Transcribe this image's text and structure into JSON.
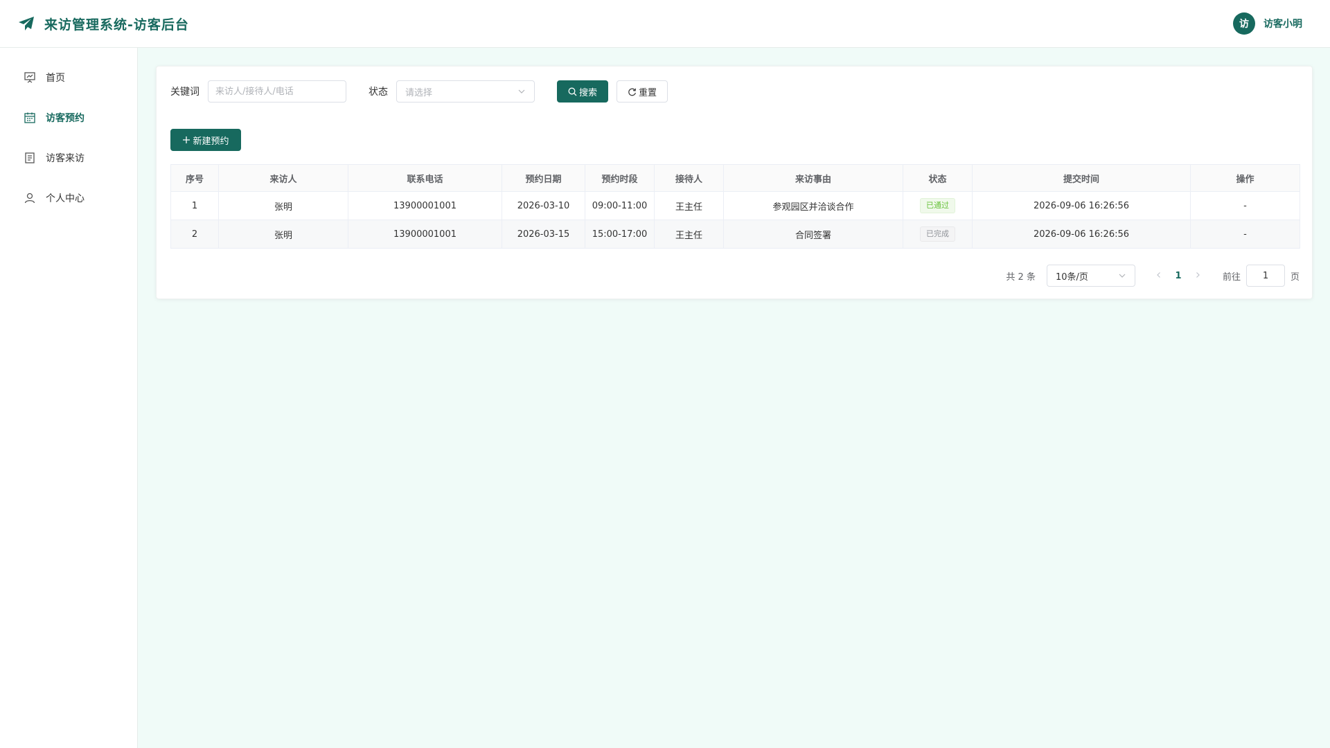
{
  "header": {
    "title": "来访管理系统-访客后台",
    "avatar_text": "访",
    "user_name": "访客小明",
    "brand_color": "#17695e"
  },
  "sidebar": {
    "items": [
      {
        "label": "首页",
        "icon": "presentation-icon",
        "active": false
      },
      {
        "label": "访客预约",
        "icon": "calendar-icon",
        "active": true
      },
      {
        "label": "访客来访",
        "icon": "document-icon",
        "active": false
      },
      {
        "label": "个人中心",
        "icon": "user-icon",
        "active": false
      }
    ]
  },
  "filters": {
    "keyword_label": "关键词",
    "keyword_placeholder": "来访人/接待人/电话",
    "status_label": "状态",
    "status_placeholder": "请选择",
    "search_label": "搜索",
    "reset_label": "重置"
  },
  "actions": {
    "create_label": "新建预约"
  },
  "table": {
    "headers": [
      "序号",
      "来访人",
      "联系电话",
      "预约日期",
      "预约时段",
      "接待人",
      "来访事由",
      "状态",
      "提交时间",
      "操作"
    ],
    "rows": [
      {
        "index": "1",
        "visitor": "张明",
        "phone": "13900001001",
        "date": "2026-03-10",
        "time_slot": "09:00-11:00",
        "host": "王主任",
        "reason": "参观园区并洽谈合作",
        "status": "已通过",
        "submitted_at": "2026-09-06 16:26:56",
        "operation": "-"
      },
      {
        "index": "2",
        "visitor": "张明",
        "phone": "13900001001",
        "date": "2026-03-15",
        "time_slot": "15:00-17:00",
        "host": "王主任",
        "reason": "合同签署",
        "status": "已完成",
        "submitted_at": "2026-09-06 16:26:56",
        "operation": "-"
      }
    ],
    "status_colors": {
      "已通过": {
        "text": "#67c23a",
        "bg": "#f0f9eb",
        "border": "#e1f3d8"
      },
      "已完成": {
        "text": "#909399",
        "bg": "#f4f4f5",
        "border": "#e9e9eb"
      }
    }
  },
  "pagination": {
    "total_text": "共 2 条",
    "page_size": "10条/页",
    "current_page": "1",
    "goto_label": "前往",
    "goto_value": "1",
    "page_suffix": "页"
  }
}
